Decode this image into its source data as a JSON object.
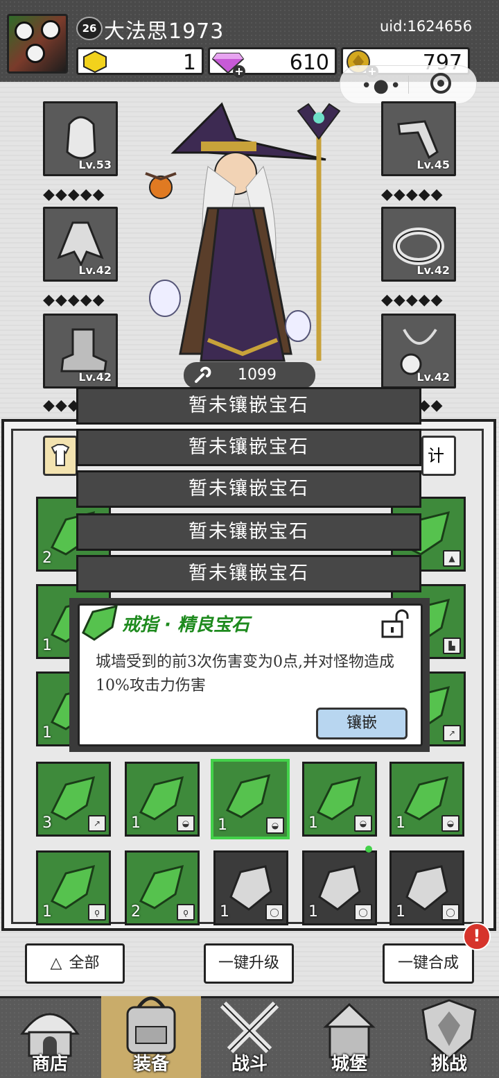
{
  "header": {
    "level": "26",
    "player_name": "大法思1973",
    "uid": "uid:1624656",
    "currencies": {
      "gold_hex": "1",
      "diamond": "610",
      "coin": "797"
    }
  },
  "equipment": {
    "left": [
      {
        "item": "helmet",
        "level": "Lv.53"
      },
      {
        "item": "cape",
        "level": "Lv.42"
      },
      {
        "item": "boots",
        "level": "Lv.42"
      }
    ],
    "right": [
      {
        "item": "bracer",
        "level": "Lv.45"
      },
      {
        "item": "ring",
        "level": "Lv.42"
      },
      {
        "item": "necklace",
        "level": "Lv.42"
      }
    ],
    "diamond_row": "◆◆◆◆◆"
  },
  "power": "1099",
  "panel_tab_right_partial": "计",
  "sockets": [
    "暂未镶嵌宝石",
    "暂未镶嵌宝石",
    "暂未镶嵌宝石",
    "暂未镶嵌宝石",
    "暂未镶嵌宝石"
  ],
  "popup": {
    "title": "戒指 · 精良宝石",
    "description": "城墙受到的前3次伤害变为0点,并对怪物造成10%攻击力伤害",
    "inlay_button": "镶嵌"
  },
  "grid_counts_visible": {
    "row1_left": "2",
    "row2_left": "1",
    "row3_left": "1",
    "row4": [
      "3",
      "1",
      "1",
      "1",
      "1"
    ],
    "row5": [
      "1",
      "2",
      "1",
      "1",
      "1"
    ]
  },
  "actions": {
    "all": "全部",
    "upgrade_all": "一键升级",
    "merge_all": "一键合成",
    "badge": "!"
  },
  "nav": [
    "商店",
    "装备",
    "战斗",
    "城堡",
    "挑战"
  ],
  "colors": {
    "accent_green": "#3e8a3b",
    "selected_border": "#43d14a",
    "badge_red": "#d6332b",
    "inlay_button": "#b8d6f0",
    "nav_active": "#c9ac6a"
  }
}
